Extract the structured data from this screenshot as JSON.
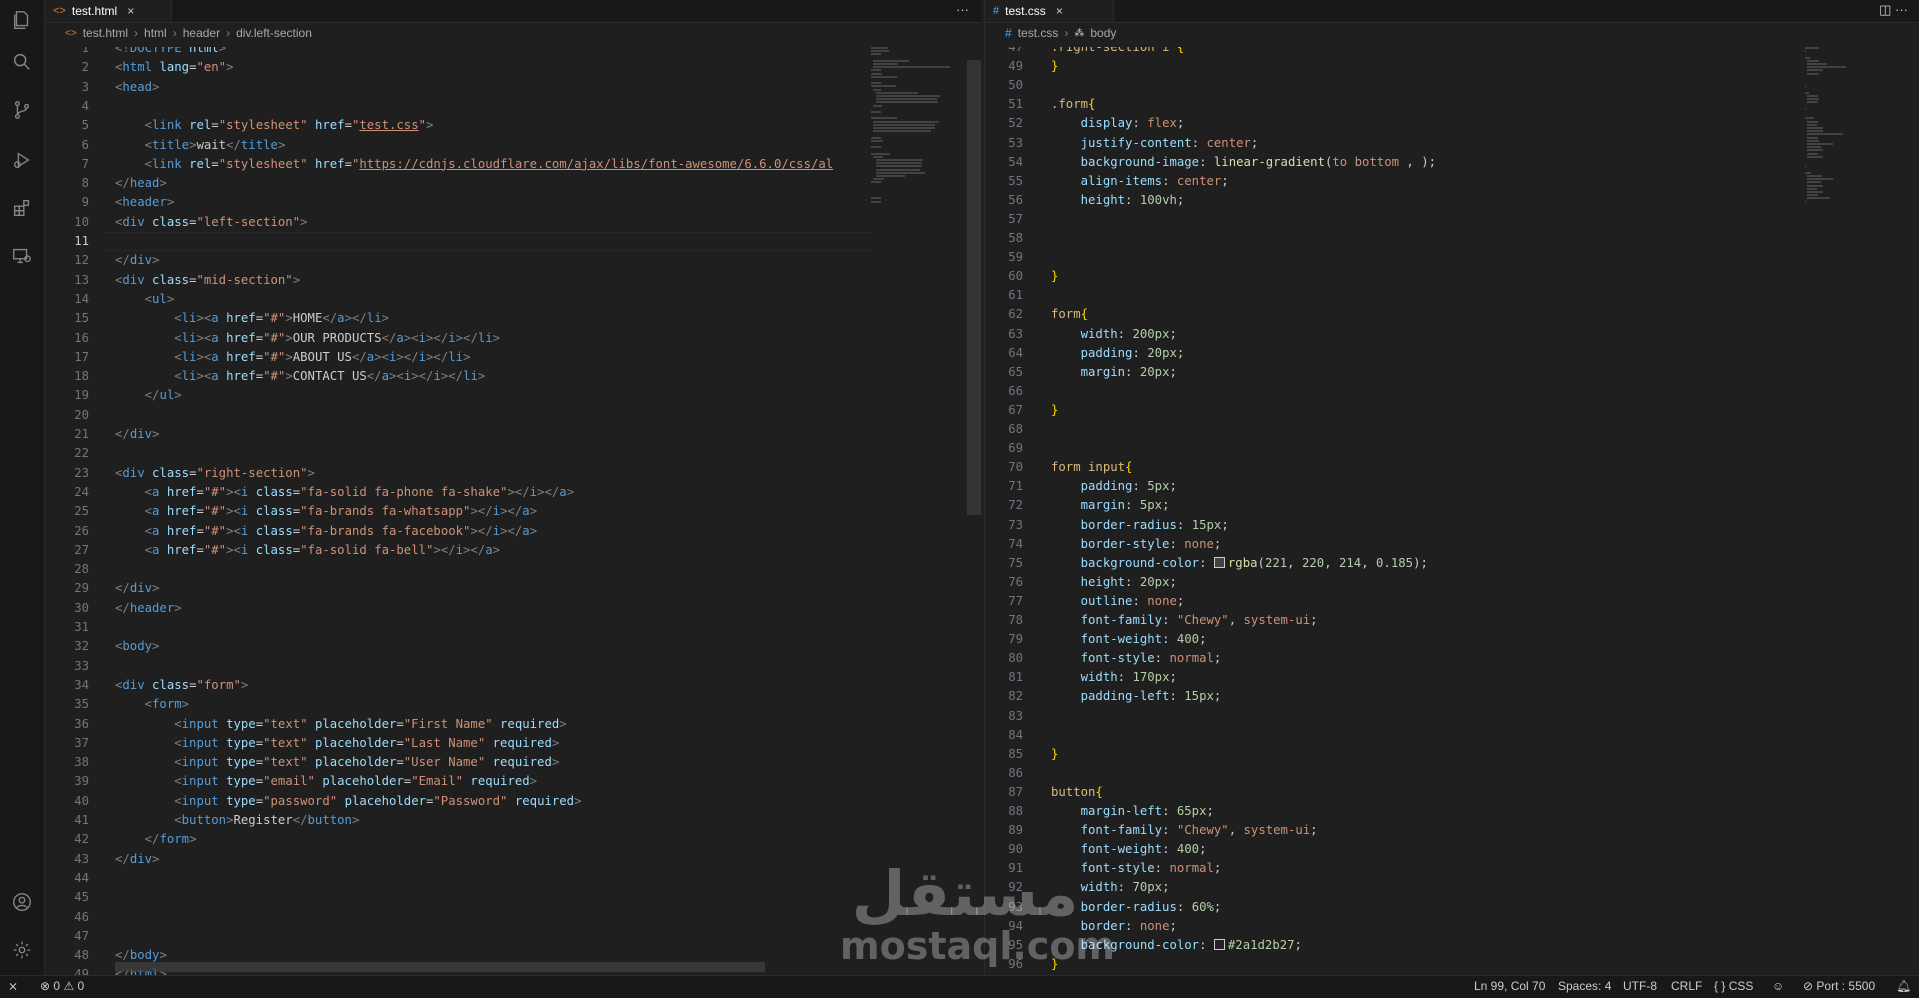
{
  "left": {
    "tab": {
      "icon": "<>",
      "label": "test.html",
      "close": "×"
    },
    "tab_actions": "···",
    "breadcrumb": [
      "test.html",
      "html",
      "header",
      "div.left-section"
    ],
    "current_line": 11,
    "lines": [
      {
        "n": 1,
        "h": "<span class='p'>&lt;!</span><span class='t'>DOCTYPE</span> <span class='a'>html</span><span class='p'>&gt;</span>"
      },
      {
        "n": 2,
        "h": "<span class='p'>&lt;</span><span class='t'>html</span> <span class='a'>lang</span>=<span class='s'>\"en\"</span><span class='p'>&gt;</span>"
      },
      {
        "n": 3,
        "h": "<span class='p'>&lt;</span><span class='t'>head</span><span class='p'>&gt;</span>"
      },
      {
        "n": 4,
        "h": ""
      },
      {
        "n": 5,
        "h": "    <span class='p'>&lt;</span><span class='t'>link</span> <span class='a'>rel</span>=<span class='s'>\"stylesheet\"</span> <span class='a'>href</span>=<span class='s'>\"</span><span class='u'>test.css</span><span class='s'>\"</span><span class='p'>&gt;</span>"
      },
      {
        "n": 6,
        "h": "    <span class='p'>&lt;</span><span class='t'>title</span><span class='p'>&gt;</span>wait<span class='p'>&lt;/</span><span class='t'>title</span><span class='p'>&gt;</span>"
      },
      {
        "n": 7,
        "h": "    <span class='p'>&lt;</span><span class='t'>link</span> <span class='a'>rel</span>=<span class='s'>\"stylesheet\"</span> <span class='a'>href</span>=<span class='s'>\"</span><span class='u'>https://cdnjs.cloudflare.com/ajax/libs/font-awesome/6.6.0/css/al</span>"
      },
      {
        "n": 8,
        "h": "<span class='p'>&lt;/</span><span class='t'>head</span><span class='p'>&gt;</span>"
      },
      {
        "n": 9,
        "h": "<span class='p'>&lt;</span><span class='t'>header</span><span class='p'>&gt;</span>"
      },
      {
        "n": 10,
        "h": "<span class='p'>&lt;</span><span class='t'>div</span> <span class='a'>class</span>=<span class='s'>\"left-section\"</span><span class='p'>&gt;</span>"
      },
      {
        "n": 11,
        "h": ""
      },
      {
        "n": 12,
        "h": "<span class='p'>&lt;/</span><span class='t'>div</span><span class='p'>&gt;</span>"
      },
      {
        "n": 13,
        "h": "<span class='p'>&lt;</span><span class='t'>div</span> <span class='a'>class</span>=<span class='s'>\"mid-section\"</span><span class='p'>&gt;</span>"
      },
      {
        "n": 14,
        "h": "    <span class='p'>&lt;</span><span class='t'>ul</span><span class='p'>&gt;</span>"
      },
      {
        "n": 15,
        "h": "        <span class='p'>&lt;</span><span class='t'>li</span><span class='p'>&gt;&lt;</span><span class='t'>a</span> <span class='a'>href</span>=<span class='s'>\"#\"</span><span class='p'>&gt;</span>HOME<span class='p'>&lt;/</span><span class='t'>a</span><span class='p'>&gt;&lt;/</span><span class='t'>li</span><span class='p'>&gt;</span>"
      },
      {
        "n": 16,
        "h": "        <span class='p'>&lt;</span><span class='t'>li</span><span class='p'>&gt;&lt;</span><span class='t'>a</span> <span class='a'>href</span>=<span class='s'>\"#\"</span><span class='p'>&gt;</span>OUR PRODUCTS<span class='p'>&lt;/</span><span class='t'>a</span><span class='p'>&gt;&lt;</span><span class='t'>i</span><span class='p'>&gt;&lt;/</span><span class='t'>i</span><span class='p'>&gt;&lt;/</span><span class='t'>li</span><span class='p'>&gt;</span>"
      },
      {
        "n": 17,
        "h": "        <span class='p'>&lt;</span><span class='t'>li</span><span class='p'>&gt;&lt;</span><span class='t'>a</span> <span class='a'>href</span>=<span class='s'>\"#\"</span><span class='p'>&gt;</span>ABOUT US<span class='p'>&lt;/</span><span class='t'>a</span><span class='p'>&gt;&lt;</span><span class='t'>i</span><span class='p'>&gt;&lt;/</span><span class='t'>i</span><span class='p'>&gt;&lt;/</span><span class='t'>li</span><span class='p'>&gt;</span>"
      },
      {
        "n": 18,
        "h": "        <span class='p'>&lt;</span><span class='t'>li</span><span class='p'>&gt;&lt;</span><span class='t'>a</span> <span class='a'>href</span>=<span class='s'>\"#\"</span><span class='p'>&gt;</span>CONTACT US<span class='p'>&lt;/</span><span class='t'>a</span><span class='p'>&gt;&lt;</span><span class='t'>i</span><span class='p'>&gt;&lt;/</span><span class='t'>i</span><span class='p'>&gt;&lt;/</span><span class='t'>li</span><span class='p'>&gt;</span>"
      },
      {
        "n": 19,
        "h": "    <span class='p'>&lt;/</span><span class='t'>ul</span><span class='p'>&gt;</span>"
      },
      {
        "n": 20,
        "h": ""
      },
      {
        "n": 21,
        "h": "<span class='p'>&lt;/</span><span class='t'>div</span><span class='p'>&gt;</span>"
      },
      {
        "n": 22,
        "h": ""
      },
      {
        "n": 23,
        "h": "<span class='p'>&lt;</span><span class='t'>div</span> <span class='a'>class</span>=<span class='s'>\"right-section\"</span><span class='p'>&gt;</span>"
      },
      {
        "n": 24,
        "h": "    <span class='p'>&lt;</span><span class='t'>a</span> <span class='a'>href</span>=<span class='s'>\"#\"</span><span class='p'>&gt;&lt;</span><span class='t'>i</span> <span class='a'>class</span>=<span class='s'>\"fa-solid fa-phone fa-shake\"</span><span class='p'>&gt;&lt;/</span><span class='t'>i</span><span class='p'>&gt;&lt;/</span><span class='t'>a</span><span class='p'>&gt;</span>"
      },
      {
        "n": 25,
        "h": "    <span class='p'>&lt;</span><span class='t'>a</span> <span class='a'>href</span>=<span class='s'>\"#\"</span><span class='p'>&gt;&lt;</span><span class='t'>i</span> <span class='a'>class</span>=<span class='s'>\"fa-brands fa-whatsapp\"</span><span class='p'>&gt;&lt;/</span><span class='t'>i</span><span class='p'>&gt;&lt;/</span><span class='t'>a</span><span class='p'>&gt;</span>"
      },
      {
        "n": 26,
        "h": "    <span class='p'>&lt;</span><span class='t'>a</span> <span class='a'>href</span>=<span class='s'>\"#\"</span><span class='p'>&gt;&lt;</span><span class='t'>i</span> <span class='a'>class</span>=<span class='s'>\"fa-brands fa-facebook\"</span><span class='p'>&gt;&lt;/</span><span class='t'>i</span><span class='p'>&gt;&lt;/</span><span class='t'>a</span><span class='p'>&gt;</span>"
      },
      {
        "n": 27,
        "h": "    <span class='p'>&lt;</span><span class='t'>a</span> <span class='a'>href</span>=<span class='s'>\"#\"</span><span class='p'>&gt;&lt;</span><span class='t'>i</span> <span class='a'>class</span>=<span class='s'>\"fa-solid fa-bell\"</span><span class='p'>&gt;&lt;/</span><span class='t'>i</span><span class='p'>&gt;&lt;/</span><span class='t'>a</span><span class='p'>&gt;</span>"
      },
      {
        "n": 28,
        "h": ""
      },
      {
        "n": 29,
        "h": "<span class='p'>&lt;/</span><span class='t'>div</span><span class='p'>&gt;</span>"
      },
      {
        "n": 30,
        "h": "<span class='p'>&lt;/</span><span class='t'>header</span><span class='p'>&gt;</span>"
      },
      {
        "n": 31,
        "h": ""
      },
      {
        "n": 32,
        "h": "<span class='p'>&lt;</span><span class='t'>body</span><span class='p'>&gt;</span>"
      },
      {
        "n": 33,
        "h": ""
      },
      {
        "n": 34,
        "h": "<span class='p'>&lt;</span><span class='t'>div</span> <span class='a'>class</span>=<span class='s'>\"form\"</span><span class='p'>&gt;</span>"
      },
      {
        "n": 35,
        "h": "    <span class='p'>&lt;</span><span class='t'>form</span><span class='p'>&gt;</span>"
      },
      {
        "n": 36,
        "h": "        <span class='p'>&lt;</span><span class='t'>input</span> <span class='a'>type</span>=<span class='s'>\"text\"</span> <span class='a'>placeholder</span>=<span class='s'>\"First Name\"</span> <span class='a'>required</span><span class='p'>&gt;</span>"
      },
      {
        "n": 37,
        "h": "        <span class='p'>&lt;</span><span class='t'>input</span> <span class='a'>type</span>=<span class='s'>\"text\"</span> <span class='a'>placeholder</span>=<span class='s'>\"Last Name\"</span> <span class='a'>required</span><span class='p'>&gt;</span>"
      },
      {
        "n": 38,
        "h": "        <span class='p'>&lt;</span><span class='t'>input</span> <span class='a'>type</span>=<span class='s'>\"text\"</span> <span class='a'>placeholder</span>=<span class='s'>\"User Name\"</span> <span class='a'>required</span><span class='p'>&gt;</span>"
      },
      {
        "n": 39,
        "h": "        <span class='p'>&lt;</span><span class='t'>input</span> <span class='a'>type</span>=<span class='s'>\"email\"</span> <span class='a'>placeholder</span>=<span class='s'>\"Email\"</span> <span class='a'>required</span><span class='p'>&gt;</span>"
      },
      {
        "n": 40,
        "h": "        <span class='p'>&lt;</span><span class='t'>input</span> <span class='a'>type</span>=<span class='s'>\"password\"</span> <span class='a'>placeholder</span>=<span class='s'>\"Password\"</span> <span class='a'>required</span><span class='p'>&gt;</span>"
      },
      {
        "n": 41,
        "h": "        <span class='p'>&lt;</span><span class='t'>button</span><span class='p'>&gt;</span>Register<span class='p'>&lt;/</span><span class='t'>button</span><span class='p'>&gt;</span>"
      },
      {
        "n": 42,
        "h": "    <span class='p'>&lt;/</span><span class='t'>form</span><span class='p'>&gt;</span>"
      },
      {
        "n": 43,
        "h": "<span class='p'>&lt;/</span><span class='t'>div</span><span class='p'>&gt;</span>"
      },
      {
        "n": 44,
        "h": ""
      },
      {
        "n": 45,
        "h": ""
      },
      {
        "n": 46,
        "h": ""
      },
      {
        "n": 47,
        "h": ""
      },
      {
        "n": 48,
        "h": "<span class='p'>&lt;/</span><span class='t'>body</span><span class='p'>&gt;</span>"
      },
      {
        "n": 49,
        "h": "<span class='p'>&lt;/</span><span class='t'>html</span><span class='p'>&gt;</span>"
      }
    ]
  },
  "right": {
    "tab": {
      "icon": "#",
      "label": "test.css",
      "close": "×"
    },
    "tab_actions": "◫  ···",
    "breadcrumb": [
      "test.css",
      "body"
    ],
    "lines": [
      {
        "n": 47,
        "h": "<span class='sel'>.right-section i</span> <span class='br'>{</span>"
      },
      {
        "n": 49,
        "h": "<span class='br'>}</span>"
      },
      {
        "n": 50,
        "h": ""
      },
      {
        "n": 51,
        "h": "<span class='sel'>.form</span><span class='br'>{</span>"
      },
      {
        "n": 52,
        "h": "    <span class='a'>display</span>: <span class='s'>flex</span>;"
      },
      {
        "n": 53,
        "h": "    <span class='a'>justify-content</span>: <span class='s'>center</span>;"
      },
      {
        "n": 54,
        "h": "    <span class='a'>background-image</span>: <span class='f'>linear-gradient</span>(<span class='s'>to bottom</span> , );"
      },
      {
        "n": 55,
        "h": "    <span class='a'>align-items</span>: <span class='s'>center</span>;"
      },
      {
        "n": 56,
        "h": "    <span class='a'>height</span>: <span class='n'>100vh</span>;"
      },
      {
        "n": 57,
        "h": ""
      },
      {
        "n": 58,
        "h": ""
      },
      {
        "n": 59,
        "h": ""
      },
      {
        "n": 60,
        "h": "<span class='br'>}</span>"
      },
      {
        "n": 61,
        "h": ""
      },
      {
        "n": 62,
        "h": "<span class='sel'>form</span><span class='br'>{</span>"
      },
      {
        "n": 63,
        "h": "    <span class='a'>width</span>: <span class='n'>200px</span>;"
      },
      {
        "n": 64,
        "h": "    <span class='a'>padding</span>: <span class='n'>20px</span>;"
      },
      {
        "n": 65,
        "h": "    <span class='a'>margin</span>: <span class='n'>20px</span>;"
      },
      {
        "n": 66,
        "h": ""
      },
      {
        "n": 67,
        "h": "<span class='br'>}</span>"
      },
      {
        "n": 68,
        "h": ""
      },
      {
        "n": 69,
        "h": ""
      },
      {
        "n": 70,
        "h": "<span class='sel'>form input</span><span class='br'>{</span>"
      },
      {
        "n": 71,
        "h": "    <span class='a'>padding</span>: <span class='n'>5px</span>;"
      },
      {
        "n": 72,
        "h": "    <span class='a'>margin</span>: <span class='n'>5px</span>;"
      },
      {
        "n": 73,
        "h": "    <span class='a'>border-radius</span>: <span class='n'>15px</span>;"
      },
      {
        "n": 74,
        "h": "    <span class='a'>border-style</span>: <span class='s'>none</span>;"
      },
      {
        "n": 75,
        "h": "    <span class='a'>background-color</span>: <span class='swatch' style='background:rgba(221,220,214,0.185)'></span><span class='f'>rgba</span>(<span class='n'>221</span>, <span class='n'>220</span>, <span class='n'>214</span>, <span class='n'>0.185</span>);"
      },
      {
        "n": 76,
        "h": "    <span class='a'>height</span>: <span class='n'>20px</span>;"
      },
      {
        "n": 77,
        "h": "    <span class='a'>outline</span>: <span class='s'>none</span>;"
      },
      {
        "n": 78,
        "h": "    <span class='a'>font-family</span>: <span class='s'>\"Chewy\"</span>, <span class='s'>system-ui</span>;"
      },
      {
        "n": 79,
        "h": "    <span class='a'>font-weight</span>: <span class='n'>400</span>;"
      },
      {
        "n": 80,
        "h": "    <span class='a'>font-style</span>: <span class='s'>normal</span>;"
      },
      {
        "n": 81,
        "h": "    <span class='a'>width</span>: <span class='n'>170px</span>;"
      },
      {
        "n": 82,
        "h": "    <span class='a'>padding-left</span>: <span class='n'>15px</span>;"
      },
      {
        "n": 83,
        "h": ""
      },
      {
        "n": 84,
        "h": ""
      },
      {
        "n": 85,
        "h": "<span class='br'>}</span>"
      },
      {
        "n": 86,
        "h": ""
      },
      {
        "n": 87,
        "h": "<span class='sel'>button</span><span class='br'>{</span>"
      },
      {
        "n": 88,
        "h": "    <span class='a'>margin-left</span>: <span class='n'>65px</span>;"
      },
      {
        "n": 89,
        "h": "    <span class='a'>font-family</span>: <span class='s'>\"Chewy\"</span>, <span class='s'>system-ui</span>;"
      },
      {
        "n": 90,
        "h": "    <span class='a'>font-weight</span>: <span class='n'>400</span>;"
      },
      {
        "n": 91,
        "h": "    <span class='a'>font-style</span>: <span class='s'>normal</span>;"
      },
      {
        "n": 92,
        "h": "    <span class='a'>width</span>: <span class='n'>70px</span>;"
      },
      {
        "n": 93,
        "h": "    <span class='a'>border-radius</span>: <span class='n'>60%</span>;"
      },
      {
        "n": 94,
        "h": "    <span class='a'>border</span>: <span class='s'>none</span>;"
      },
      {
        "n": 95,
        "h": "    <span class='a'>background-color</span>: <span class='swatch' style='background:#2a1d2b'></span><span class='n'>#2a1d2b27</span>;"
      },
      {
        "n": 96,
        "h": "<span class='br'>}</span>"
      }
    ]
  },
  "status": {
    "errors": "0",
    "warnings": "0",
    "position": "Ln 99, Col 70",
    "spaces": "Spaces: 4",
    "encoding": "UTF-8",
    "eol": "CRLF",
    "language": "CSS",
    "port": "Port : 5500"
  },
  "watermark": {
    "arabic": "مستقل",
    "latin": "mostaql.com"
  },
  "colors": {
    "background": "#1f1f1f",
    "tag": "#569cd6",
    "attribute": "#9cdcfe",
    "string": "#ce9178",
    "selector": "#d7ba7d",
    "number": "#b5cea8",
    "brace": "#ffd700"
  },
  "icons": [
    "explorer-icon",
    "search-icon",
    "source-control-icon",
    "run-debug-icon",
    "extensions-icon",
    "remote-explorer-icon",
    "account-icon",
    "settings-gear-icon"
  ]
}
